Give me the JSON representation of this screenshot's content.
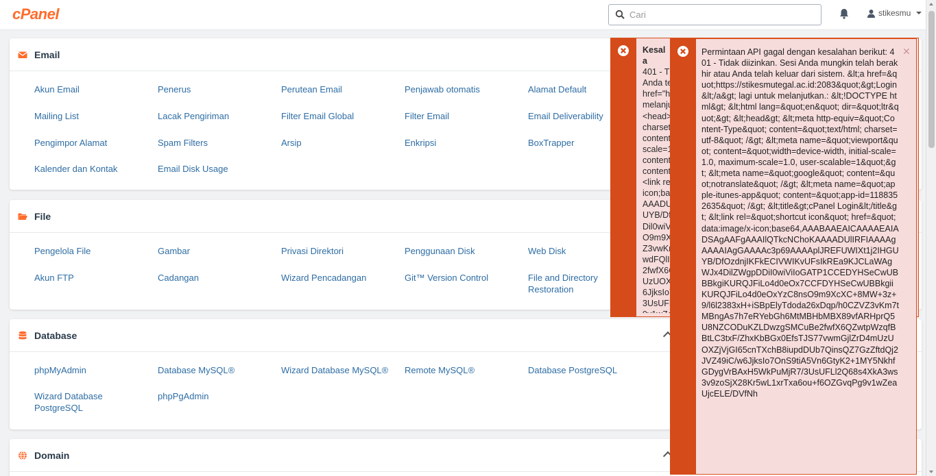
{
  "header": {
    "logo_text": "cPanel",
    "search_placeholder": "Cari",
    "username": "stikesmu"
  },
  "panels": {
    "email": {
      "title": "Email",
      "items": [
        "Akun Email",
        "Penerus",
        "Perutean Email",
        "Penjawab otomatis",
        "Alamat Default",
        "Mailing List",
        "Lacak Pengiriman",
        "Filter Email Global",
        "Filter Email",
        "Email Deliverability",
        "Pengimpor Alamat",
        "Spam Filters",
        "Arsip",
        "Enkripsi",
        "BoxTrapper",
        "Kalender dan Kontak",
        "Email Disk Usage"
      ]
    },
    "file": {
      "title": "File",
      "items": [
        "Pengelola File",
        "Gambar",
        "Privasi Direktori",
        "Penggunaan Disk",
        "Web Disk",
        "Akun FTP",
        "Cadangan",
        "Wizard Pencadangan",
        "Git™ Version Control",
        "File and Directory Restoration"
      ]
    },
    "database": {
      "title": "Database",
      "items": [
        "phpMyAdmin",
        "Database MySQL®",
        "Wizard Database MySQL®",
        "Remote MySQL®",
        "Database PostgreSQL",
        "Wizard Database PostgreSQL",
        "phpPgAdmin"
      ]
    },
    "domain": {
      "title": "Domain"
    }
  },
  "toasts": {
    "back_title": "Kesala",
    "back_lines": [
      "401 - T",
      "Anda telah k",
      "href=\"https",
      "melanjutkan",
      "<head> <me",
      "charset=utf",
      "content=\"wi",
      "scale=1.0, us",
      "content=\"n",
      "content=\"ap",
      "<link rel=\"sh",
      "icon;base6",
      "AAADUlIRFI",
      "UYB/DfOzdnj",
      "Dil0wiViIoG",
      "O9m9XcXC+",
      "Z3vwKm7t",
      "wdFQlIOZCV",
      "2fwfX6QZwtp",
      "UzUOXZjVjG",
      "6JjksIo7OnS",
      "3UsUFLl2Q6",
      "9v1wZeaUjc"
    ],
    "front_message": "Permintaan API gagal dengan kesalahan berikut: 401 - Tidak diizinkan. Sesi Anda mungkin telah berakhir atau Anda telah keluar dari sistem. &lt;a href=&quot;https://stikesmutegal.ac.id:2083&quot;&gt;Login&lt;/a&gt; lagi untuk melanjutkan.: &lt;!DOCTYPE html&gt; &lt;html lang=&quot;en&quot; dir=&quot;ltr&quot;&gt; &lt;head&gt; &lt;meta http-equiv=&quot;Content-Type&quot; content=&quot;text/html; charset=utf-8&quot; /&gt; &lt;meta name=&quot;viewport&quot; content=&quot;width=device-width, initial-scale=1.0, maximum-scale=1.0, user-scalable=1&quot;&gt; &lt;meta name=&quot;google&quot; content=&quot;notranslate&quot; /&gt; &lt;meta name=&quot;apple-itunes-app&quot; content=&quot;app-id=1188352635&quot; /&gt; &lt;title&gt;cPanel Login&lt;/title&gt; &lt;link rel=&quot;shortcut icon&quot; href=&quot;data:image/x-icon;base64,AAABAAEAICAAAAEAIADSAgAAFgAAAIlQTkcNChoKAAAADUlIRFIAAAAgAAAAIAgGAAAAc3p69AAAAplJREFUWIXt1j2IHGUYB/DfOzdnjIKFkECIVWIKvUFsIkREa9KJCLaWAgWJx4DilZWgpDDiI0wiViIoGATP1CCEDYHSeCwUBBBkgiKURQJFiLo4d0eOx7CCFDYHSeCwUBBkgiiKURQJFiLo4d0eOxYzC8nsO9m9XcXC+8MW+3z+9/l6l2383xH+iSBpElyTdoda26xDqp/h0CZVZ3vKm7tMBngAs7h7eRYebGh6MtMBHbMBX89vfARHprQ5U8NZCODuKZLDwzgSMCuBe2fwfX6QZwtpWzqfBBtLC3txF/ZhxKbBGx0EfsTJS77vwmGjlZrD4mUzUOXZjVjGI65cnTXchB8iupdDUb7QinsQZ7GzZftdQj2JVZ49iC/w6JjksIo7OnS9tiA5Vn6GtyK2+1MY5NkhfGDygVrBAxH5WkPuMjR7/3UsUFLl2Q68s4XkA3ws3v9zoSjX28Kr5wL1xrTxa6ou+f6OZGvqPg9v1wZeaUjcELE/DVfNh"
  },
  "colors": {
    "brand": "#ff6c2c",
    "link": "#2e6da4",
    "error_bar": "#d54b19",
    "error_bg": "#f7dcdc"
  }
}
